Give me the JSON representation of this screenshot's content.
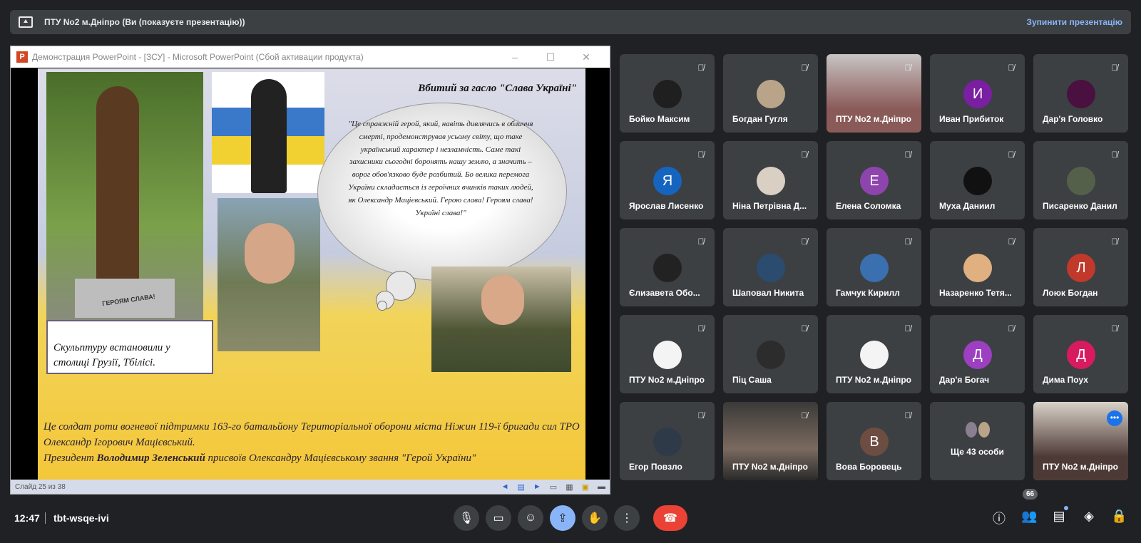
{
  "banner": {
    "title": "ПТУ No2 м.Дніпро (Ви (показуєте презентацію))",
    "stop_label": "Зупинити презентацію"
  },
  "ppt": {
    "window_title": "Демонстрация PowerPoint - [ЗСУ] - Microsoft PowerPoint (Сбой активации продукта)",
    "app_letter": "P",
    "status": "Слайд 25 из 38",
    "slide": {
      "heading": "Вбитий за гасло \"Слава Україні\"",
      "cloud_text": "\"Це справжній герой, який, навіть дивлячись в обличчя смерті, продемонстрував усьому світу, що таке український характер і незламність. Саме такі захисники сьогодні боронять нашу землю, а значить – ворог обов'язково буде розбитий. Бо велика перемога України складається із героїчних вчинків таких людей, як Олександр Мацієвський. Герою слава! Героям слава! Україні слава!\"",
      "caption": "Скульптуру встановили у столиці Грузії, Тбілісі.",
      "bottom_line1": "Це солдат роти вогневої підтримки 163-го батальйону Територіальної оборони міста Ніжин 119-ї бригади сил ТРО Олександр Ігорович Мацієвський.",
      "bottom_line2a": "Президент ",
      "bottom_bold": "Володимир Зеленський",
      "bottom_line2b": " присвоїв Олександру Мацієвському звання \"Герой України\"",
      "statue_plaque": "ГЕРОЯМ СЛАВА!"
    }
  },
  "participants": [
    {
      "name": "Бойко Максим",
      "avatar_color": "#1f1f1f",
      "initial": ""
    },
    {
      "name": "Богдан Гугля",
      "avatar_color": "#b9a48a",
      "initial": ""
    },
    {
      "name": "ПТУ No2 м.Дніпро",
      "avatar_color": "",
      "initial": "",
      "video": true
    },
    {
      "name": "Иван Прибиток",
      "avatar_color": "#7b1fa2",
      "initial": "И"
    },
    {
      "name": "Дар'я Головко",
      "avatar_color": "#4a1040",
      "initial": ""
    },
    {
      "name": "Ярослав Лисенко",
      "avatar_color": "#1565c0",
      "initial": "Я"
    },
    {
      "name": "Ніна Петрівна Д...",
      "avatar_color": "#d9cfc2",
      "initial": ""
    },
    {
      "name": "Елена Соломка",
      "avatar_color": "#8e44ad",
      "initial": "Е"
    },
    {
      "name": "Муха Даниил",
      "avatar_color": "#111111",
      "initial": ""
    },
    {
      "name": "Писаренко Данил",
      "avatar_color": "#55604a",
      "initial": ""
    },
    {
      "name": "Єлизавета Обо...",
      "avatar_color": "#222222",
      "initial": ""
    },
    {
      "name": "Шаповал Никита",
      "avatar_color": "#2b4c6e",
      "initial": ""
    },
    {
      "name": "Гамчук Кирилл",
      "avatar_color": "#3a6fb0",
      "initial": ""
    },
    {
      "name": "Назаренко Тетя...",
      "avatar_color": "#e0b080",
      "initial": ""
    },
    {
      "name": "Лоюк Богдан",
      "avatar_color": "#c0392b",
      "initial": "Л"
    },
    {
      "name": "ПТУ No2 м.Дніпро",
      "avatar_color": "#f4f4f4",
      "initial": ""
    },
    {
      "name": "Піц Саша",
      "avatar_color": "#2c2c2c",
      "initial": ""
    },
    {
      "name": "ПТУ No2 м.Дніпро",
      "avatar_color": "#f4f4f4",
      "initial": ""
    },
    {
      "name": "Дар'я Богач",
      "avatar_color": "#9c3fc0",
      "initial": "Д"
    },
    {
      "name": "Дима Поух",
      "avatar_color": "#d81b60",
      "initial": "Д"
    },
    {
      "name": "Егор Повзло",
      "avatar_color": "#2f3a48",
      "initial": ""
    },
    {
      "name": "ПТУ No2 м.Дніпро",
      "avatar_color": "",
      "initial": "",
      "video": true
    },
    {
      "name": "Вова Боровець",
      "avatar_color": "#6d4c41",
      "initial": "В"
    },
    {
      "name": "",
      "more": "Ще 43 особи"
    },
    {
      "name": "ПТУ No2 м.Дніпро",
      "avatar_color": "",
      "initial": "",
      "video": true,
      "active": true
    }
  ],
  "bottom": {
    "time": "12:47",
    "meeting_code": "tbt-wsqe-ivi",
    "people_count": "66"
  },
  "colors": {
    "background": "#202124",
    "tile": "#3c4043",
    "accent": "#8ab4f8",
    "end_call": "#ea4335"
  }
}
